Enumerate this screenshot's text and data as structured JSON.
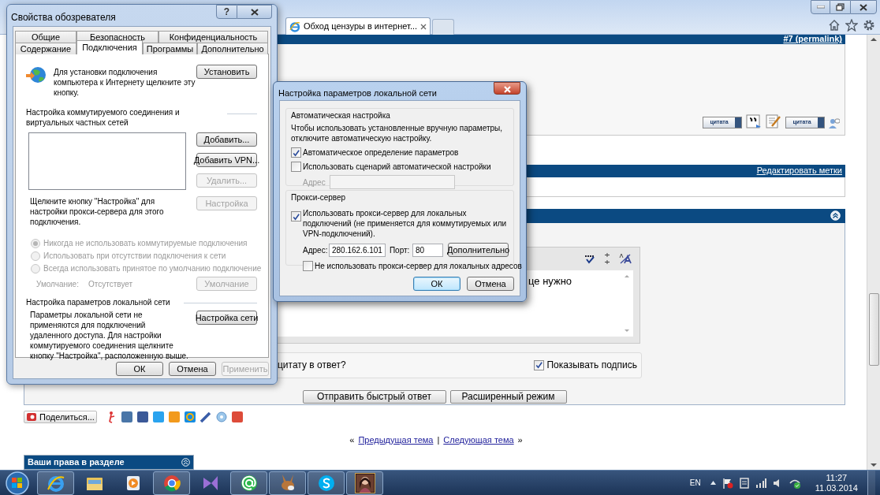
{
  "browser": {
    "tab_title": "Обход цензуры в интернет...",
    "post": {
      "permalink": "#7 (permalink)",
      "actions": [
        {
          "kind": "quote",
          "label": "цитата"
        },
        {
          "kind": "reply-icon"
        },
        {
          "kind": "edit-icon"
        },
        {
          "kind": "multiquote",
          "label": "цитата"
        }
      ]
    },
    "tags_bar": {
      "link": "Редактировать метки"
    },
    "quick_reply": {
      "editor_text": "це нужно",
      "quote_option": "цитату в ответ?",
      "show_signature": {
        "label": "Показывать подпись",
        "checked": true
      },
      "buttons": [
        "Отправить быстрый ответ",
        "Расширенный режим"
      ]
    },
    "share": {
      "button": "Поделиться..."
    },
    "nav": {
      "left_mark": "«",
      "prev": "Предыдущая тема",
      "separator": "|",
      "next": "Следующая тема",
      "right_mark": "»"
    },
    "rights_panel": {
      "title": "Ваши права в разделе"
    }
  },
  "internet_options": {
    "title": "Свойства обозревателя",
    "help": "?",
    "tab_rows": [
      [
        {
          "label": "Общие",
          "selected": false
        },
        {
          "label": "Безопасность",
          "selected": false
        },
        {
          "label": "Конфиденциальность",
          "selected": false
        }
      ],
      [
        {
          "label": "Содержание",
          "selected": false
        },
        {
          "label": "Подключения",
          "selected": true
        },
        {
          "label": "Программы",
          "selected": false
        },
        {
          "label": "Дополнительно",
          "selected": false
        }
      ]
    ],
    "setup": {
      "text": "Для установки подключения компьютера к Интернету щелкните эту кнопку.",
      "button": "Установить"
    },
    "dialup": {
      "heading": "Настройка коммутируемого соединения и виртуальных частных сетей",
      "buttons": [
        {
          "label": "Добавить...",
          "disabled": false
        },
        {
          "label": "Добавить VPN...",
          "disabled": false
        },
        {
          "label": "Удалить...",
          "disabled": true
        }
      ],
      "proxy_text": "Щелкните кнопку \"Настройка\" для настройки прокси-сервера для этого подключения.",
      "settings_button": {
        "label": "Настройка",
        "disabled": true
      },
      "options": [
        {
          "label": "Никогда не использовать коммутируемые подключения",
          "selected": true,
          "disabled": true
        },
        {
          "label": "Использовать при отсутствии подключения к сети",
          "selected": false,
          "disabled": true
        },
        {
          "label": "Всегда использовать принятое по умолчанию подключение",
          "selected": false,
          "disabled": true
        }
      ],
      "default_label": "Умолчание:",
      "default_value": "Отсутствует",
      "default_button": {
        "label": "Умолчание",
        "disabled": true
      }
    },
    "lan": {
      "heading": "Настройка параметров локальной сети",
      "text": "Параметры локальной сети не применяются для подключений удаленного доступа. Для настройки коммутируемого соединения щелкните кнопку \"Настройка\", расположенную выше.",
      "button": "Настройка сети"
    },
    "footer_buttons": [
      {
        "label": "ОК",
        "disabled": false
      },
      {
        "label": "Отмена",
        "disabled": false
      },
      {
        "label": "Применить",
        "disabled": true
      }
    ]
  },
  "lan_settings": {
    "title": "Настройка параметров локальной сети",
    "auto": {
      "heading": "Автоматическая настройка",
      "text": "Чтобы использовать установленные вручную параметры, отключите автоматическую настройку.",
      "options": [
        {
          "label": "Автоматическое определение параметров",
          "checked": true
        },
        {
          "label": "Использовать сценарий автоматической настройки",
          "checked": false
        }
      ],
      "address_label": "Адрес",
      "address_disabled": true
    },
    "proxy": {
      "heading": "Прокси-сервер",
      "use_proxy": {
        "label": "Использовать прокси-сервер для локальных подключений (не применяется для коммутируемых или VPN-подключений).",
        "checked": true
      },
      "address_label": "Адрес:",
      "address": "280.162.6.101",
      "port_label": "Порт:",
      "port": "80",
      "advanced_button": "Дополнительно",
      "bypass_local": {
        "label": "Не использовать прокси-сервер для локальных адресов",
        "checked": false
      }
    },
    "buttons": [
      {
        "label": "ОК",
        "default": true
      },
      {
        "label": "Отмена",
        "default": false
      }
    ]
  },
  "taskbar": {
    "apps": [
      {
        "kind": "ie",
        "running": true
      },
      {
        "kind": "folder",
        "running": false
      },
      {
        "kind": "media",
        "running": false
      },
      {
        "kind": "chrome",
        "running": true
      },
      {
        "kind": "studio",
        "running": false
      },
      {
        "kind": "mail",
        "running": true
      },
      {
        "kind": "donkey",
        "running": true
      },
      {
        "kind": "skype",
        "running": true
      },
      {
        "kind": "picture",
        "running": true
      }
    ],
    "language": "EN",
    "time": "11:27",
    "date": "11.03.2014"
  }
}
